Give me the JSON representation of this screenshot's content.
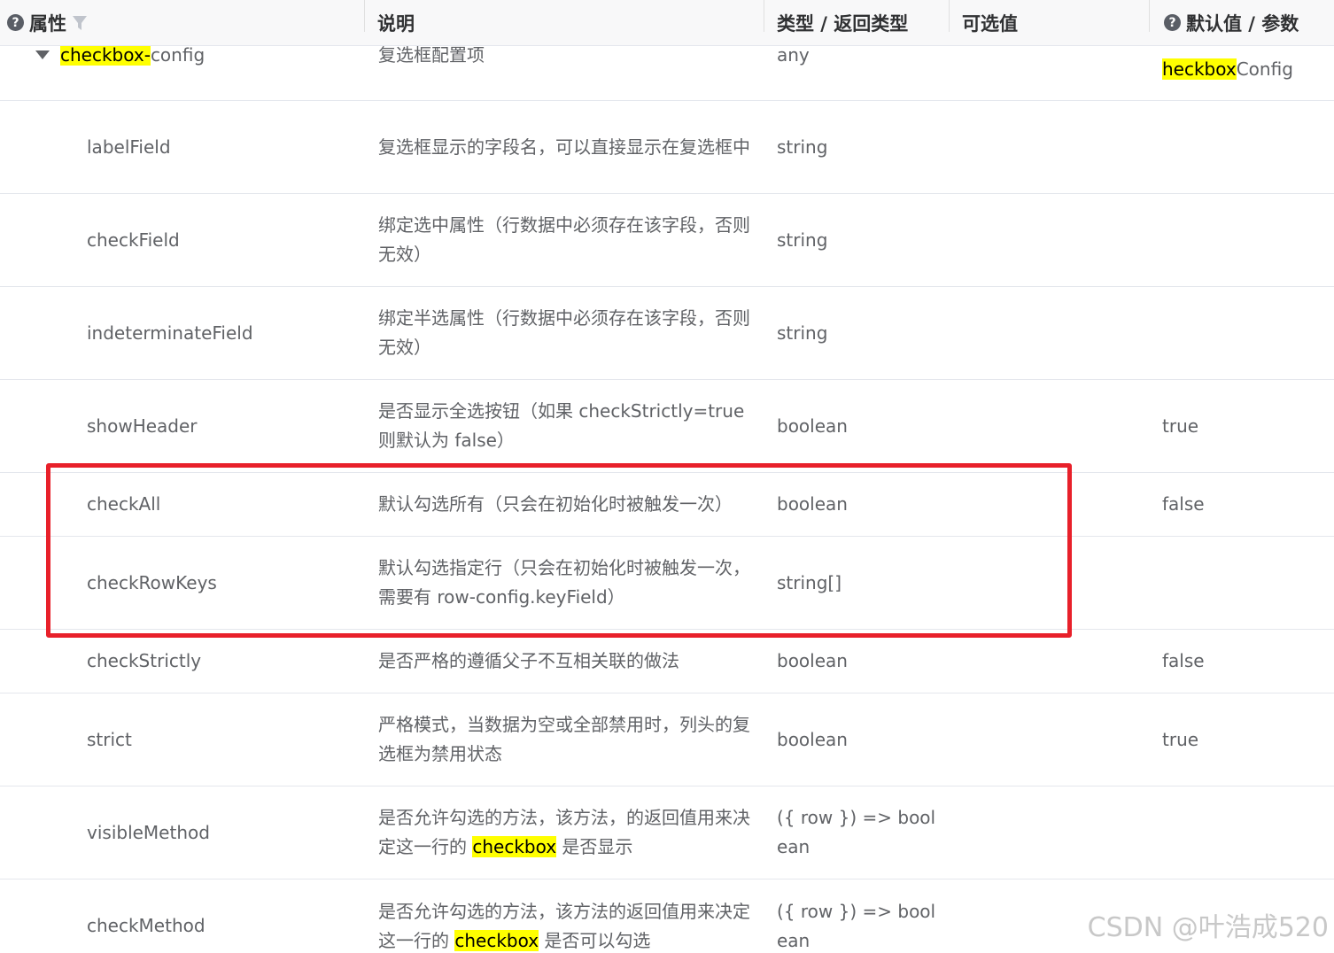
{
  "header": {
    "col_name": "属性",
    "col_desc": "说明",
    "col_type": "类型 / 返回类型",
    "col_options": "可选值",
    "col_default": "默认值 / 参数"
  },
  "parent_row": {
    "name_hl": "checkbox-",
    "name_rest": "config",
    "desc": "复选框配置项",
    "type": "any",
    "default_hl": "heckbox",
    "default_rest": "Config"
  },
  "rows": [
    {
      "name": "labelField",
      "desc": "复选框显示的字段名，可以直接显示在复选框中",
      "type": "string",
      "default": ""
    },
    {
      "name": "checkField",
      "desc": "绑定选中属性（行数据中必须存在该字段，否则无效）",
      "type": "string",
      "default": ""
    },
    {
      "name": "indeterminateField",
      "desc": "绑定半选属性（行数据中必须存在该字段，否则无效）",
      "type": "string",
      "default": ""
    },
    {
      "name": "showHeader",
      "desc": "是否显示全选按钮（如果 checkStrictly=true 则默认为 false）",
      "type": "boolean",
      "default": "true"
    },
    {
      "name": "checkAll",
      "desc": "默认勾选所有（只会在初始化时被触发一次）",
      "type": "boolean",
      "default": "false"
    },
    {
      "name": "checkRowKeys",
      "desc": "默认勾选指定行（只会在初始化时被触发一次，需要有 row-config.keyField）",
      "type": "string[]",
      "default": ""
    },
    {
      "name": "checkStrictly",
      "desc": "是否严格的遵循父子不互相关联的做法",
      "type": "boolean",
      "default": "false"
    },
    {
      "name": "strict",
      "desc": "严格模式，当数据为空或全部禁用时，列头的复选框为禁用状态",
      "type": "boolean",
      "default": "true"
    },
    {
      "name": "visibleMethod",
      "desc_a": "是否允许勾选的方法，该方法，的返回值用来决定这一行的 ",
      "desc_hl": "checkbox",
      "desc_b": " 是否显示",
      "type": "({ row }) => boolean",
      "default": ""
    },
    {
      "name": "checkMethod",
      "desc_a": "是否允许勾选的方法，该方法的返回值用来决定这一行的 ",
      "desc_hl": "checkbox",
      "desc_b": " 是否可以勾选",
      "type": "({ row }) => boolean",
      "default": ""
    }
  ],
  "watermark": "CSDN @叶浩成520",
  "colors": {
    "highlight": "#ffff00",
    "annotation_box": "#e8202a",
    "header_bg": "#f8f8f9"
  }
}
